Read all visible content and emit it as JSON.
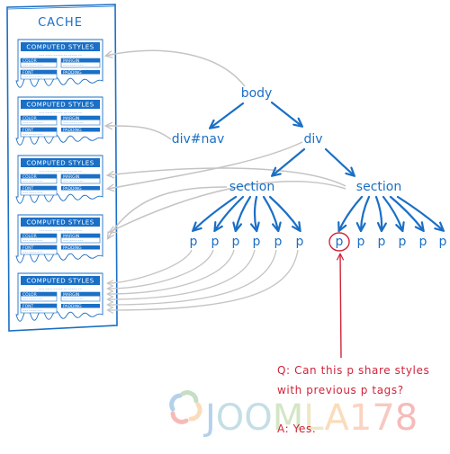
{
  "colors": {
    "blue": "#1a6fc6",
    "gray_link": "#c4c4c4",
    "red": "#d0243a",
    "watermark": [
      "#5b9bd5",
      "#7fb77e",
      "#f6b26b",
      "#ea6b66"
    ]
  },
  "cache": {
    "title": "CACHE",
    "cards": [
      {
        "title": "COMPUTED STYLES",
        "subtitle": "~~~ ~~~~ ~~~~~ ~~ ~~~~~ ~~",
        "fields": [
          {
            "label": "COLOR",
            "value": "~~~ ~~~~ ~~~"
          },
          {
            "label": "MARGIN",
            "value": "~~~ ~~~~ ~~~"
          },
          {
            "label": "FONT",
            "value": "~~~ ~~~~ ~~~"
          },
          {
            "label": "PADDING",
            "value": ""
          }
        ]
      },
      {
        "title": "COMPUTED STYLES",
        "subtitle": "~~~ ~~~~ ~~~~~ ~~ ~~~~~ ~~",
        "fields": [
          {
            "label": "COLOR",
            "value": "~~~ ~~~~ ~~~"
          },
          {
            "label": "MARGIN",
            "value": "~~~ ~~~~ ~~~"
          },
          {
            "label": "FONT",
            "value": "~~~ ~~~~ ~~~"
          },
          {
            "label": "PADDING",
            "value": ""
          }
        ]
      },
      {
        "title": "COMPUTED STYLES",
        "subtitle": "~~~ ~~~~ ~~~~~ ~~ ~~~~~ ~~",
        "fields": [
          {
            "label": "COLOR",
            "value": "~~~ ~~~~ ~~~"
          },
          {
            "label": "MARGIN",
            "value": "~~~ ~~~~ ~~~"
          },
          {
            "label": "FONT",
            "value": "~~~ ~~~~ ~~~"
          },
          {
            "label": "PADDING",
            "value": ""
          }
        ]
      },
      {
        "title": "COMPUTED STYLES",
        "subtitle": "~~~ ~~~~ ~~~~~ ~~ ~~~~~ ~~",
        "fields": [
          {
            "label": "COLOR",
            "value": "~~~ ~~~~ ~~~"
          },
          {
            "label": "MARGIN",
            "value": "~~~ ~~~~ ~~~"
          },
          {
            "label": "FONT",
            "value": "~~~ ~~~~ ~~~"
          },
          {
            "label": "PADDING",
            "value": ""
          }
        ]
      },
      {
        "title": "COMPUTED STYLES",
        "subtitle": "~~~ ~~~~ ~~~~~ ~~ ~~~~~ ~~",
        "fields": [
          {
            "label": "COLOR",
            "value": "~~~ ~~~~ ~~~"
          },
          {
            "label": "MARGIN",
            "value": "~~~ ~~~~ ~~~"
          },
          {
            "label": "FONT",
            "value": "~~~ ~~~~ ~~~"
          },
          {
            "label": "PADDING",
            "value": ""
          }
        ]
      }
    ]
  },
  "tree": {
    "root": "body",
    "nav": "div#nav",
    "div": "div",
    "section_left": "section",
    "section_right": "section",
    "p_label": "p",
    "left_p_count": 6,
    "right_p_count": 6,
    "highlighted_p": "right-0"
  },
  "question": {
    "line1": "Q: Can this p share styles",
    "line2": "with previous p tags?",
    "answer": "A: Yes."
  },
  "watermark": {
    "text_parts": [
      "J",
      "OO",
      "M",
      "L",
      "A",
      "1",
      "7",
      "8"
    ]
  }
}
